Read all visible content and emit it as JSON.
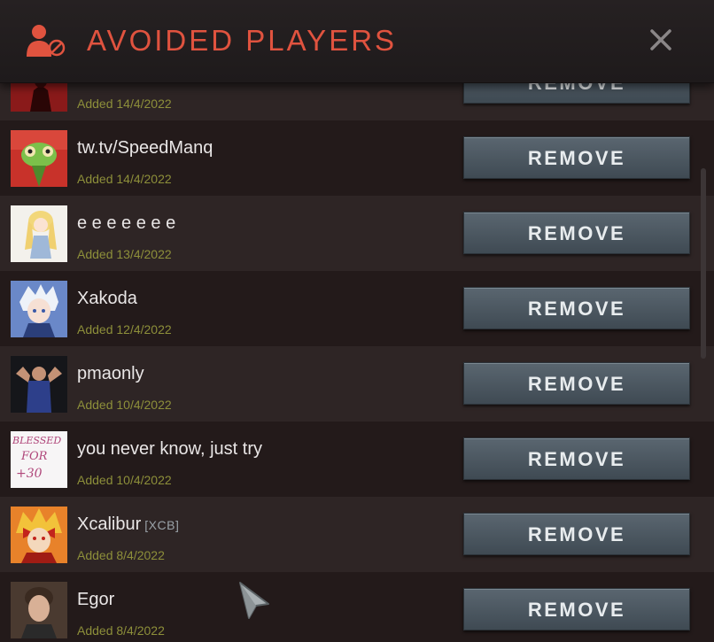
{
  "header": {
    "title": "AVOIDED PLAYERS",
    "accent_color": "#e0533f",
    "icon": "avoid-user-icon",
    "close_icon": "close-icon"
  },
  "players": [
    {
      "name": "",
      "tag": "",
      "added": "Added 14/4/2022",
      "remove_label": "REMOVE"
    },
    {
      "name": "tw.tv/SpeedManq",
      "tag": "",
      "added": "Added 14/4/2022",
      "remove_label": "REMOVE"
    },
    {
      "name": "e e e e e e e",
      "tag": "",
      "added": "Added 13/4/2022",
      "remove_label": "REMOVE"
    },
    {
      "name": "Xakoda",
      "tag": "",
      "added": "Added 12/4/2022",
      "remove_label": "REMOVE"
    },
    {
      "name": "pmaonly",
      "tag": "",
      "added": "Added 10/4/2022",
      "remove_label": "REMOVE"
    },
    {
      "name": "you never know, just try",
      "tag": "",
      "added": "Added 10/4/2022",
      "remove_label": "REMOVE"
    },
    {
      "name": "Xcalibur",
      "tag": "[XCB]",
      "added": "Added 8/4/2022",
      "remove_label": "REMOVE"
    },
    {
      "name": "Egor",
      "tag": "",
      "added": "Added 8/4/2022",
      "remove_label": "REMOVE"
    }
  ],
  "avatar_text": {
    "blessed": "BLESSED",
    "for": "FOR",
    "num": "+30"
  }
}
